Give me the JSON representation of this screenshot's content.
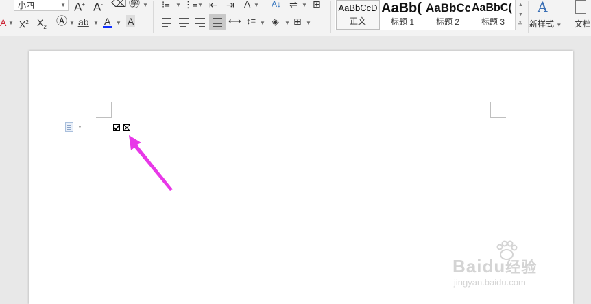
{
  "ribbon": {
    "font_size_value": "小四",
    "styles": [
      {
        "preview": "AaBbCcD",
        "label": "正文"
      },
      {
        "preview": "AaBb(",
        "label": "标题 1"
      },
      {
        "preview": "AaBbCc",
        "label": "标题 2"
      },
      {
        "preview": "AaBbC(",
        "label": "标题 3"
      }
    ],
    "new_style_label": "新样式",
    "doc_label": "文档"
  },
  "colors": {
    "font_color_underline": "#1030ff",
    "arrow": "#e838e8",
    "ribbon_bg": "#f3f3f3",
    "workspace_bg": "#e8e8e8"
  },
  "document": {
    "checkboxes": [
      {
        "state": "checked",
        "glyph": "☑"
      },
      {
        "state": "crossed",
        "glyph": "☒"
      }
    ]
  },
  "watermark": {
    "brand": "Baidu",
    "brand_cn": "经验",
    "url": "jingyan.baidu.com"
  }
}
